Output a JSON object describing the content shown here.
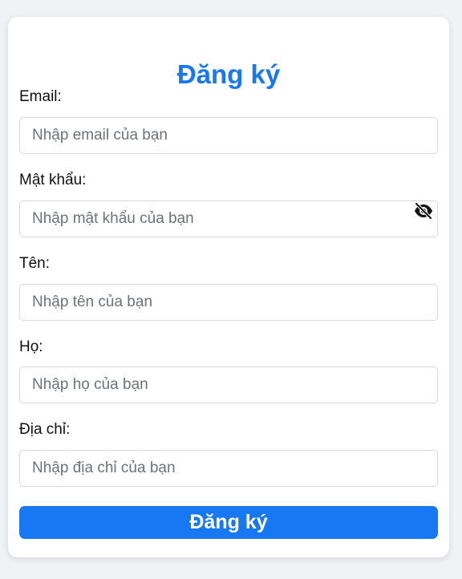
{
  "form": {
    "title": "Đăng ký",
    "fields": [
      {
        "label": "Email:",
        "placeholder": "Nhập email của bạn",
        "value": ""
      },
      {
        "label": "Mật khẩu:",
        "placeholder": "Nhập mật khẩu của bạn",
        "value": "",
        "toggle_icon": "eye-slash-icon"
      },
      {
        "label": "Tên:",
        "placeholder": "Nhập tên của bạn",
        "value": ""
      },
      {
        "label": "Họ:",
        "placeholder": "Nhập họ của bạn",
        "value": ""
      },
      {
        "label": "Địa chỉ:",
        "placeholder": "Nhập địa chỉ của bạn",
        "value": ""
      }
    ],
    "submit_label": "Đăng ký"
  },
  "colors": {
    "accent": "#1877f2",
    "background": "#f0f2f5",
    "card": "#ffffff"
  }
}
